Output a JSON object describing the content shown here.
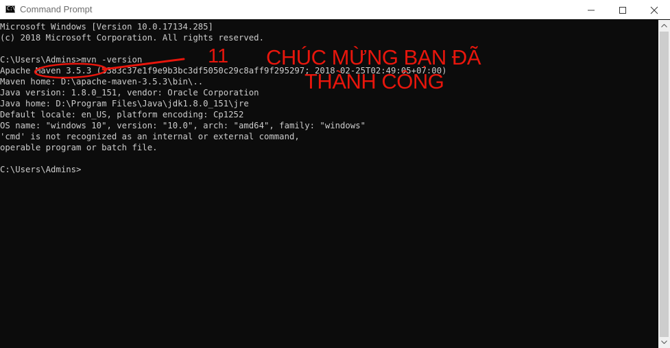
{
  "window": {
    "title": "Command Prompt",
    "icon_text": "C:\\"
  },
  "console": {
    "lines": [
      "Microsoft Windows [Version 10.0.17134.285]",
      "(c) 2018 Microsoft Corporation. All rights reserved.",
      "",
      "C:\\Users\\Admins>mvn -version",
      "Apache Maven 3.5.3 (3383c37e1f9e9b3bc3df5050c29c8aff9f295297; 2018-02-25T02:49:05+07:00)",
      "Maven home: D:\\apache-maven-3.5.3\\bin\\..",
      "Java version: 1.8.0_151, vendor: Oracle Corporation",
      "Java home: D:\\Program Files\\Java\\jdk1.8.0_151\\jre",
      "Default locale: en_US, platform encoding: Cp1252",
      "OS name: \"windows 10\", version: \"10.0\", arch: \"amd64\", family: \"windows\"",
      "'cmd' is not recognized as an internal or external command,",
      "operable program or batch file.",
      "",
      "C:\\Users\\Admins>"
    ]
  },
  "annotation": {
    "number": "11",
    "line1": "CHÚC MỪNG BẠN ĐÃ",
    "line2": "THÀNH CÔNG",
    "color": "#e8160c"
  },
  "colors": {
    "console_bg": "#0c0c0c",
    "console_text": "#cccccc",
    "titlebar_bg": "#ffffff"
  }
}
